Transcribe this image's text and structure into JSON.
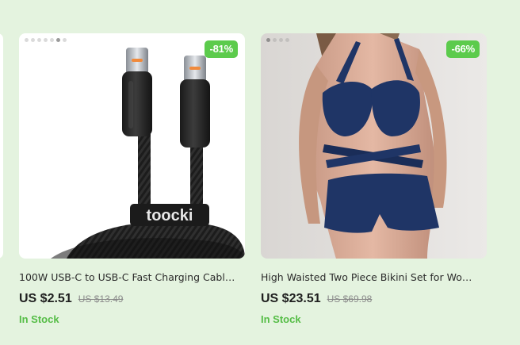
{
  "colors": {
    "background": "#e4f3df",
    "badge": "#5ccb4c",
    "in_stock": "#55bd46",
    "price": "#1f1f1f",
    "old_price": "#8a8a8a"
  },
  "products": [
    {
      "discount_badge": "-81%",
      "image_icon": "usb-c-cable-image",
      "brand_print": "toocki",
      "title": "100W USB-C to USB-C Fast Charging Cable...",
      "price": "US $2.51",
      "original_price": "US $13.49",
      "stock_status": "In Stock",
      "carousel_dots": 7,
      "active_dot": 5
    },
    {
      "discount_badge": "-66%",
      "image_icon": "bikini-set-image",
      "title": "High Waisted Two Piece Bikini Set for Women",
      "price": "US $23.51",
      "original_price": "US $69.98",
      "stock_status": "In Stock",
      "carousel_dots": 4,
      "active_dot": 0
    }
  ]
}
